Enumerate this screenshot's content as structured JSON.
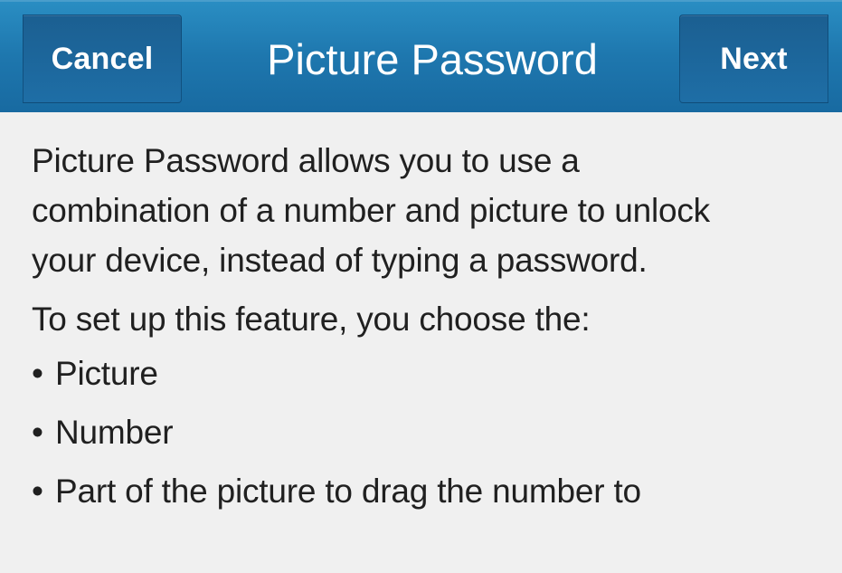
{
  "header": {
    "cancel_label": "Cancel",
    "title": "Picture Password",
    "next_label": "Next"
  },
  "body": {
    "intro": "Picture Password allows you to use a\ncombination of a number and picture to unlock\nyour device, instead of typing a password.",
    "setup_text": "To set up this feature, you choose the:",
    "items": [
      {
        "bullet": "•",
        "label": "Picture"
      },
      {
        "bullet": "•",
        "label": "Number"
      },
      {
        "bullet": "•",
        "label": "Part of the picture to drag the number to"
      }
    ]
  },
  "colors": {
    "header_blue": "#1e77ae",
    "background": "#f0f0f0",
    "text": "#202020"
  }
}
